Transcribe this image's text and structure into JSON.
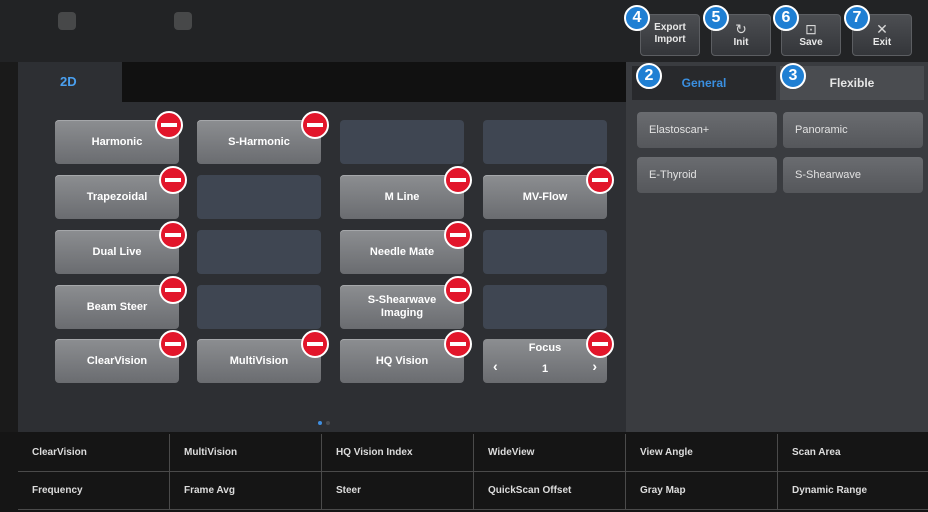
{
  "toolbar": {
    "export_import_label": "Export\nImport",
    "init_label": "Init",
    "save_label": "Save",
    "exit_label": "Exit",
    "init_icon": "refresh-icon",
    "save_icon": "save-icon",
    "exit_icon": "close-icon",
    "badges": {
      "export_import": "4",
      "init": "5",
      "save": "6",
      "exit": "7",
      "general": "2",
      "flexible": "3"
    }
  },
  "main_tabs": {
    "active": "2D"
  },
  "function_buttons": {
    "harmonic": "Harmonic",
    "s_harmonic": "S-Harmonic",
    "trapezoidal": "Trapezoidal",
    "m_line": "M Line",
    "mv_flow": "MV-Flow",
    "dual_live": "Dual Live",
    "needle_mate": "Needle Mate",
    "beam_steer": "Beam Steer",
    "s_shearwave_imaging": "S-Shearwave\nImaging",
    "clearvision": "ClearVision",
    "multivision": "MultiVision",
    "hq_vision": "HQ Vision"
  },
  "focus": {
    "label": "Focus",
    "value": "1"
  },
  "pagination": {
    "count": 2,
    "current": 1
  },
  "right_panel": {
    "tabs": {
      "general": "General",
      "flexible": "Flexible"
    },
    "presets": [
      "Elastoscan+",
      "Panoramic",
      "E-Thyroid",
      "S-Shearwave"
    ]
  },
  "bottom_grid": {
    "row1": [
      "ClearVision",
      "MultiVision",
      "HQ Vision Index",
      "WideView",
      "View Angle",
      "Scan Area"
    ],
    "row2": [
      "Frequency",
      "Frame Avg",
      "Steer",
      "QuickScan Offset",
      "Gray Map",
      "Dynamic Range"
    ]
  },
  "colors": {
    "accent_blue": "#1f7fd3",
    "active_tab_text": "#4aa0f0",
    "remove_red": "#e2162b",
    "button_gray": "#7c7e81",
    "empty_slot": "#3f4652"
  }
}
